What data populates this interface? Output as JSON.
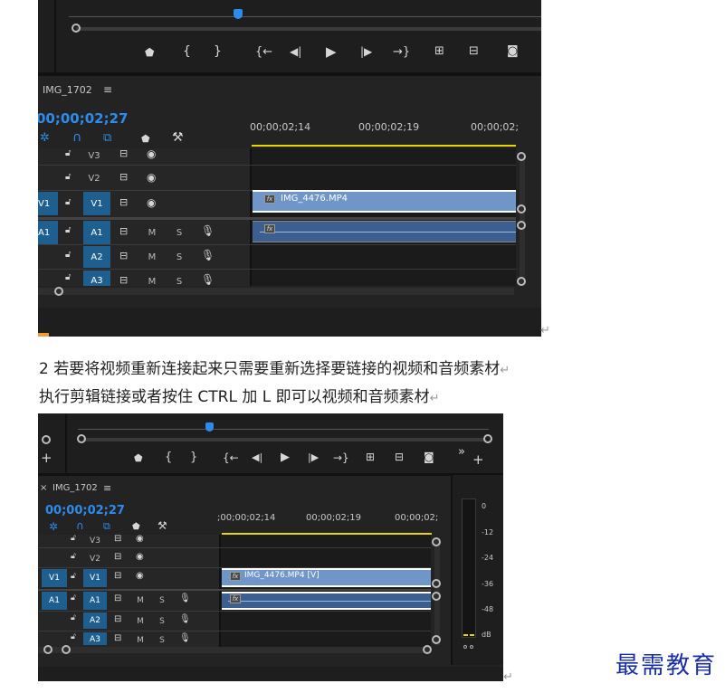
{
  "top_panel": {
    "sequence_title": "IMG_1702",
    "menu_glyph": "≡",
    "timecode": "00;00;02;27",
    "ruler_ticks": [
      "00;00;02;14",
      "00;00;02;19",
      "00;00;02;"
    ],
    "transport_icons": [
      "marker-icon",
      "mark-in-icon",
      "mark-out-icon",
      "go-to-in-icon",
      "step-back-icon",
      "play-icon",
      "step-forward-icon",
      "go-to-out-icon",
      "insert-icon",
      "overwrite-icon",
      "camera-icon"
    ],
    "tracks": [
      {
        "id": "V3",
        "source": "",
        "icons": [
          "lock",
          "film",
          "eye"
        ]
      },
      {
        "id": "V2",
        "source": "",
        "icons": [
          "lock",
          "film",
          "eye"
        ]
      },
      {
        "id": "V1",
        "source": "V1",
        "icons": [
          "lock",
          "film",
          "eye"
        ]
      },
      {
        "id": "A1",
        "source": "A1",
        "icons": [
          "lock",
          "film",
          "M",
          "S",
          "mic"
        ]
      },
      {
        "id": "A2",
        "source": "",
        "icons": [
          "lock",
          "film",
          "M",
          "S",
          "mic"
        ]
      },
      {
        "id": "A3",
        "source": "",
        "icons": [
          "lock",
          "film",
          "M",
          "S",
          "mic"
        ]
      }
    ],
    "video_clip": "IMG_4476.MP4",
    "fx_label": "fx"
  },
  "text": {
    "line1": "2 若要将视频重新连接起来只需要重新选择要链接的视频和音频素材",
    "line2": "执行剪辑链接或者按住 CTRL 加 L 即可以视频和音频素材",
    "return_glyph": "↵"
  },
  "bottom_panel": {
    "sequence_title": "IMG_1702",
    "close_glyph": "×",
    "menu_glyph": "≡",
    "timecode": "00;00;02;27",
    "ruler_ticks": [
      ";00;00;02;14",
      "00;00;02;19",
      "00;00;02;"
    ],
    "video_clip": "IMG_4476.MP4 [V]",
    "fx_label": "fx",
    "meter_labels": [
      "0",
      "-12",
      "-24",
      "-36",
      "-48",
      "dB"
    ],
    "tracks": [
      {
        "id": "V3",
        "source": ""
      },
      {
        "id": "V2",
        "source": ""
      },
      {
        "id": "V1",
        "source": "V1"
      },
      {
        "id": "A1",
        "source": "A1"
      },
      {
        "id": "A2",
        "source": ""
      },
      {
        "id": "A3",
        "source": ""
      }
    ],
    "add_glyph": "+",
    "overflow_glyph": "»"
  },
  "brand": "最需教育",
  "colors": {
    "panel": "#232323",
    "timecode": "#2d8ceb",
    "clip": "#6f95c9",
    "track_source": "#1f5f8f",
    "brand": "#1a2ea8"
  }
}
